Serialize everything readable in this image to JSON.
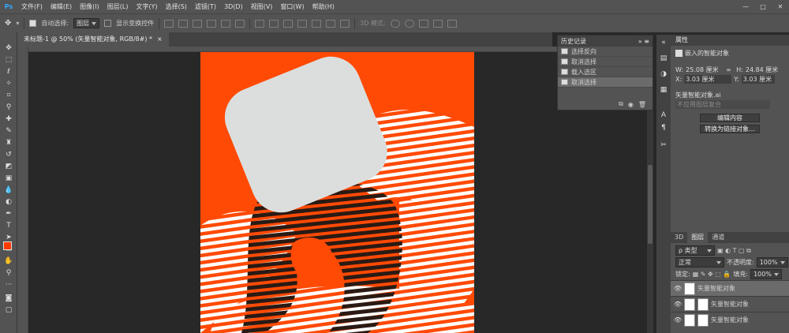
{
  "app": {
    "logo": "Ps"
  },
  "menu": [
    "文件(F)",
    "编辑(E)",
    "图像(I)",
    "图层(L)",
    "文字(Y)",
    "选择(S)",
    "滤镜(T)",
    "3D(D)",
    "视图(V)",
    "窗口(W)",
    "帮助(H)"
  ],
  "window": {
    "min": "—",
    "max": "□",
    "close": "✕"
  },
  "options": {
    "auto_select_label": "自动选择:",
    "auto_select_value": "图层",
    "show_transform_label": "显示变换控件",
    "mode_3d": "3D 模式:"
  },
  "document_tab": {
    "title": "未标题-1 @ 50% (矢量智能对象, RGB/8#) *",
    "close": "×"
  },
  "history": {
    "title": "历史记录",
    "collapse": "»",
    "menu": "≡",
    "items": [
      "选择反向",
      "取消选择",
      "载入选区",
      "取消选择"
    ],
    "active_index": 3
  },
  "properties": {
    "title": "属性",
    "type_label": "嵌入的智能对象",
    "w_label": "W:",
    "w_value": "25.08 厘米",
    "h_label": "H:",
    "h_value": "24.84 厘米",
    "x_label": "X:",
    "x_value": "3.03 厘米",
    "y_label": "Y:",
    "y_value": "3.03 厘米",
    "filename": "矢量智能对象.ai",
    "comp_placeholder": "不应用图层复合",
    "edit_button": "编辑内容",
    "convert_button": "转换为链接对象..."
  },
  "layers": {
    "tabs": [
      "3D",
      "图层",
      "通道"
    ],
    "active_tab": "图层",
    "filter_label": "ρ 类型",
    "blend_mode": "正常",
    "opacity_label": "不透明度:",
    "opacity_value": "100%",
    "lock_label": "锁定:",
    "fill_label": "填充:",
    "fill_value": "100%",
    "rows": [
      {
        "name": "矢量智能对象",
        "active": true
      },
      {
        "name": "矢量智能对象",
        "active": false
      },
      {
        "name": "矢量智能对象",
        "active": false
      }
    ]
  },
  "colors": {
    "canvas_orange": "#ff4a05",
    "shape_gray": "#dcdedd",
    "stripe_dark": "#2a1a14",
    "stripe_white": "#ffffff",
    "foreground": "#ff3b00"
  }
}
